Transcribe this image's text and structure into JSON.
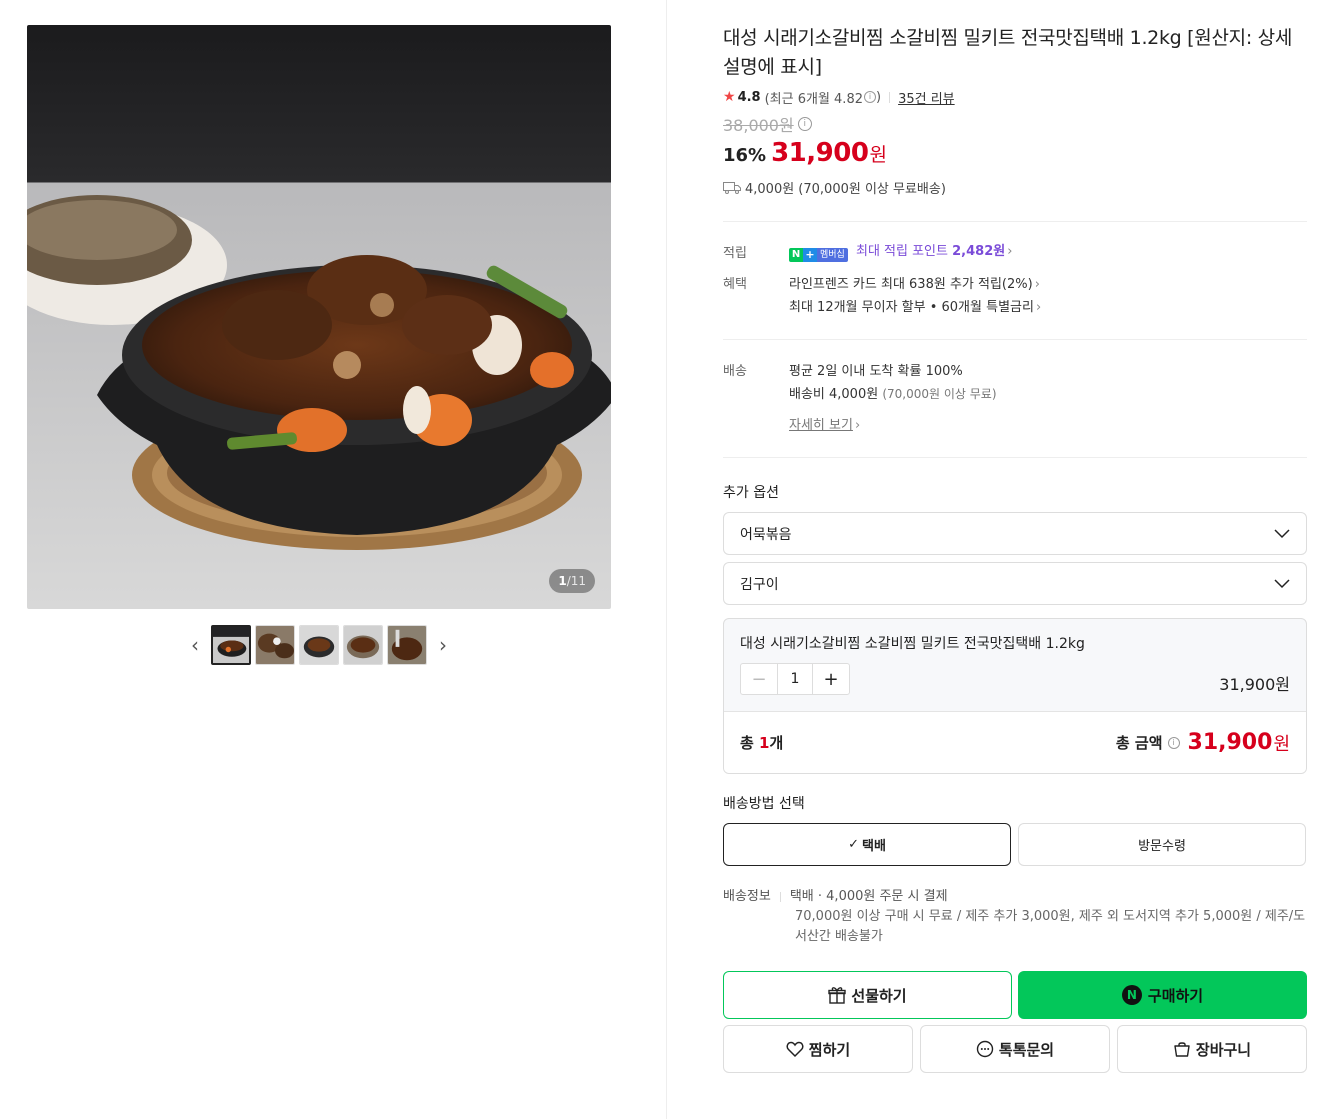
{
  "product": {
    "title": "대성 시래기소갈비찜 소갈비찜 밀키트 전국맛집택배 1.2kg [원산지: 상세설명에 표시]",
    "image_counter": {
      "current": "1",
      "total": "/11"
    },
    "rating": "4.8",
    "recent_rating": "(최근 6개월 4.82",
    "recent_rating_close": ")",
    "review_count": "35건 리뷰",
    "original_price": "38,000원",
    "discount_rate": "16%",
    "sale_price": "31,900",
    "sale_unit": "원",
    "shipping_summary": "4,000원 (70,000원 이상 무료배송)"
  },
  "benefits": {
    "points_label": "적립",
    "badge_n": "N",
    "badge_plus": "+",
    "badge_membership": "멤버십",
    "points_text": "최대 적립 포인트",
    "points_value": "2,482원",
    "benefit_label": "혜택",
    "benefit_1": "라인프렌즈 카드 최대 638원 추가 적립(2%)",
    "benefit_2": "최대 12개월 무이자 할부 • 60개월 특별금리",
    "delivery_label": "배송",
    "delivery_1": "평균 2일 이내 도착 확률 100%",
    "delivery_2a": "배송비 4,000원",
    "delivery_2b": "(70,000원 이상 무료)",
    "detail_link": "자세히 보기"
  },
  "options": {
    "title": "추가 옵션",
    "select_1": "어묵볶음",
    "select_2": "김구이"
  },
  "selected": {
    "name": "대성 시래기소갈비찜 소갈비찜 밀키트 전국맛집택배 1.2kg",
    "quantity": "1",
    "price": "31,900원",
    "total_count_prefix": "총 ",
    "total_count_num": "1",
    "total_count_suffix": "개",
    "total_label": "총 금액",
    "total_amount": "31,900",
    "total_unit": "원"
  },
  "shipping_method": {
    "title": "배송방법 선택",
    "option_1": "택배",
    "option_2": "방문수령"
  },
  "shipping_info": {
    "label": "배송정보",
    "summary": "택배 · 4,000원 주문 시 결제",
    "detail": "70,000원 이상 구매 시 무료 / 제주 추가 3,000원, 제주 외 도서지역 추가 5,000원 / 제주/도서산간 배송불가"
  },
  "actions": {
    "gift": "선물하기",
    "buy": "구매하기",
    "buy_badge": "N",
    "wish": "찜하기",
    "talk": "톡톡문의",
    "cart": "장바구니"
  },
  "colors": {
    "accent_red": "#d6001c",
    "naver_green": "#03c75a",
    "point_purple": "#7a4bd8"
  },
  "icons": [
    "star-icon",
    "info-icon",
    "truck-icon",
    "chevron-right-icon",
    "chevron-down-icon",
    "check-icon",
    "gift-icon",
    "heart-icon",
    "chat-icon",
    "cart-icon"
  ]
}
